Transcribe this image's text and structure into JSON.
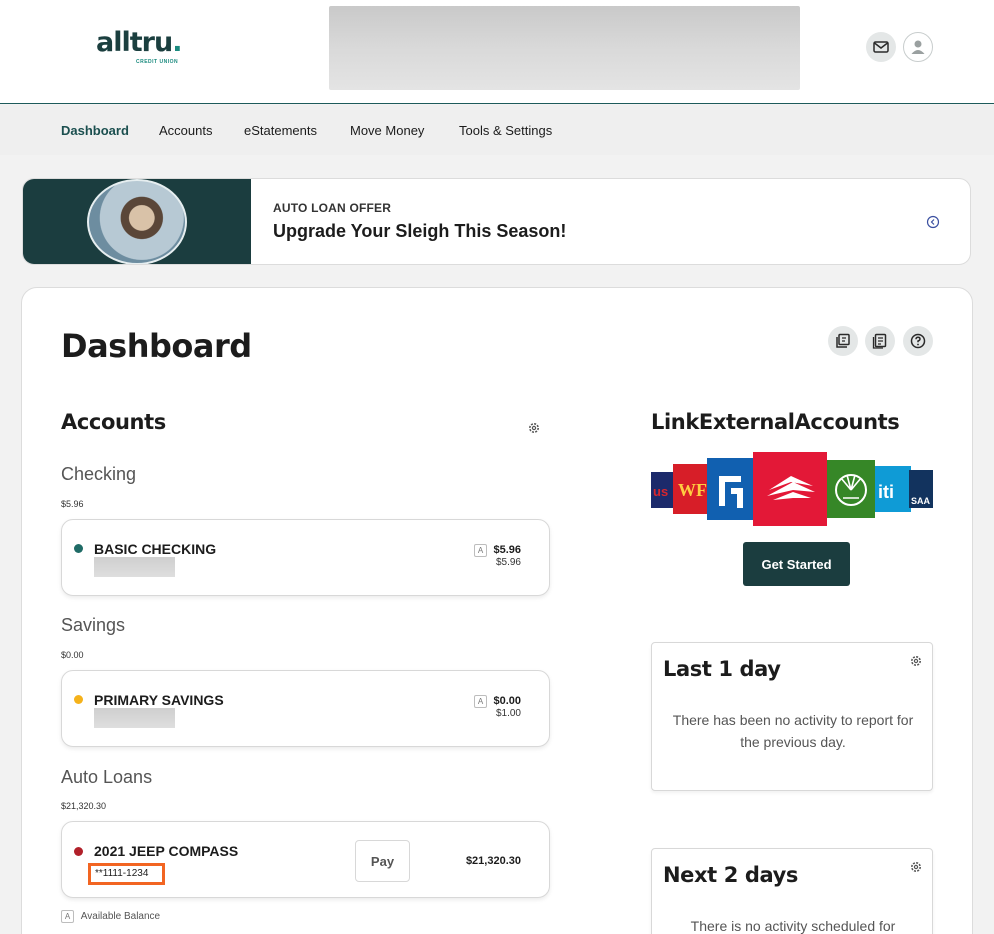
{
  "header": {
    "logo_text": "alltru",
    "logo_dot": ".",
    "logo_subtext": "CREDIT UNION"
  },
  "nav": {
    "items": [
      "Dashboard",
      "Accounts",
      "eStatements",
      "Move Money",
      "Tools & Settings"
    ],
    "active": "Dashboard"
  },
  "promo": {
    "eyebrow": "AUTO LOAN OFFER",
    "title": "Upgrade Your Sleigh This Season!"
  },
  "page": {
    "title": "Dashboard"
  },
  "accounts": {
    "heading": "Accounts",
    "groups": [
      {
        "title": "Checking",
        "total": "$5.96",
        "account": {
          "name": "BASIC CHECKING",
          "available": "$5.96",
          "current": "$5.96",
          "dot_color": "#1f6b66"
        }
      },
      {
        "title": "Savings",
        "total": "$0.00",
        "account": {
          "name": "PRIMARY SAVINGS",
          "available": "$0.00",
          "current": "$1.00",
          "dot_color": "#f5b21b"
        }
      },
      {
        "title": "Auto Loans",
        "total": "$21,320.30",
        "account": {
          "name": "2021 JEEP COMPASS",
          "number": "**1111-1234",
          "pay_label": "Pay",
          "balance": "$21,320.30",
          "dot_color": "#b1202a"
        }
      }
    ],
    "badge_letter": "A",
    "legend": "Available Balance"
  },
  "link_external": {
    "heading": "LinkExternalAccounts",
    "button": "Get Started"
  },
  "activity": [
    {
      "title": "Last 1 day",
      "message": "There has been no activity to report for the previous day."
    },
    {
      "title": "Next 2 days",
      "message": "There is no activity scheduled for"
    }
  ]
}
